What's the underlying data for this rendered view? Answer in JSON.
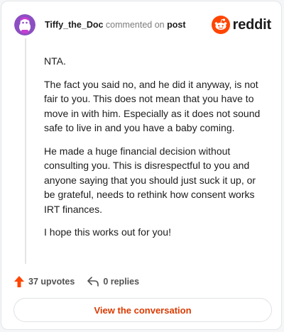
{
  "header": {
    "username": "Tiffy_the_Doc",
    "action_text": "commented on",
    "post_link": "post",
    "brand": "reddit"
  },
  "comment": {
    "paragraphs": [
      "NTA.",
      "The fact you said no, and he did it anyway, is not fair to you. This does not mean that you have to move in with him. Especially as it does not sound safe to live in and you have a baby coming.",
      "He made a huge financial decision without consulting you. This is disrespectful to you and anyone saying that you should just suck it up, or be grateful, needs to rethink how consent works IRT finances.",
      "I hope this works out for you!"
    ]
  },
  "actions": {
    "upvotes": "37 upvotes",
    "replies": "0 replies"
  },
  "cta": {
    "label": "View the conversation"
  },
  "colors": {
    "accent": "#d93a00",
    "upvote": "#ff4500",
    "text": "#1c1c1c",
    "muted": "#7c7c7c"
  },
  "icons": {
    "avatar": "snoo-avatar-purple",
    "brand": "reddit-snoo-logo",
    "upvote": "upvote-arrow-icon",
    "reply": "reply-arrow-icon"
  }
}
